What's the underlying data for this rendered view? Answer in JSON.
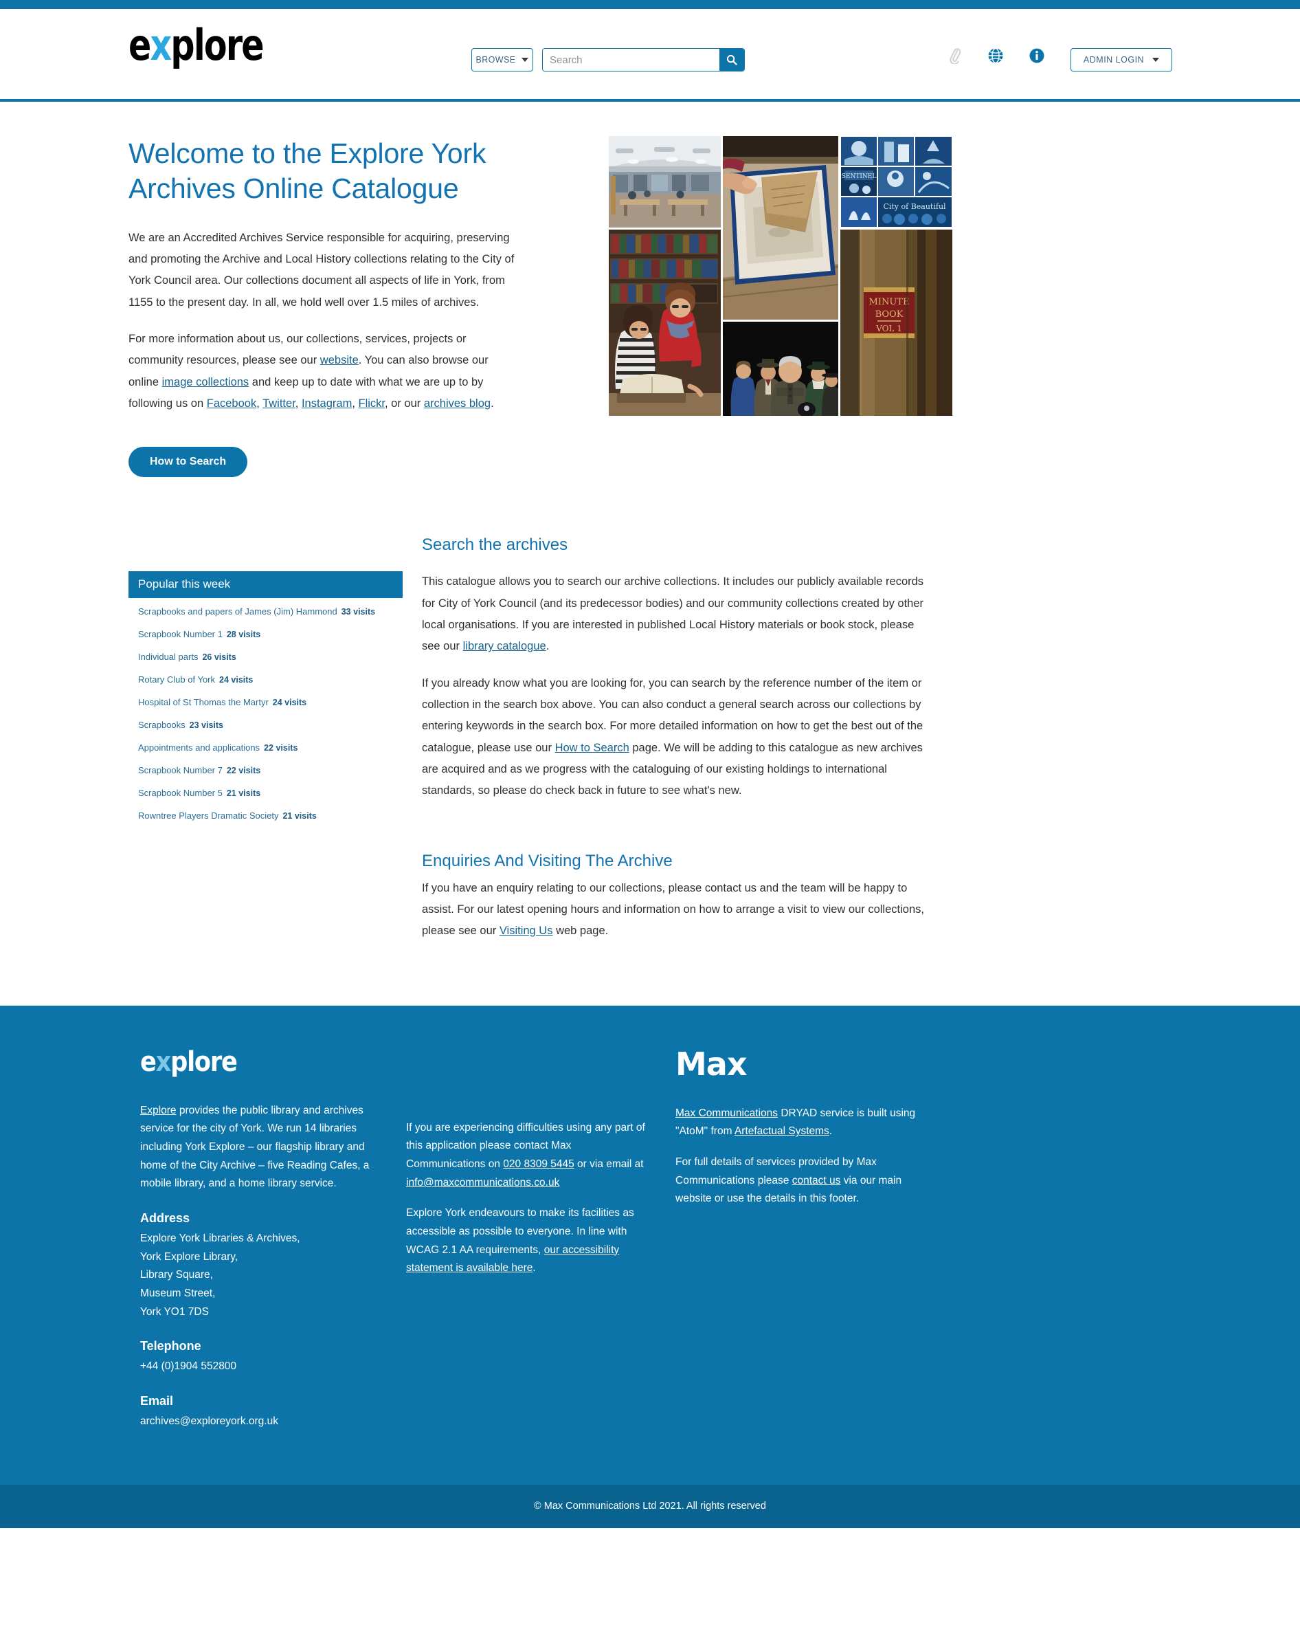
{
  "header": {
    "logo_pre": "e",
    "logo_x": "x",
    "logo_post": "plore",
    "browse_label": "BROWSE",
    "search_placeholder": "Search",
    "search_value": "",
    "admin_label": "ADMIN LOGIN",
    "icons": [
      "paperclip-icon",
      "globe-icon",
      "info-icon"
    ]
  },
  "hero": {
    "title": "Welcome to the Explore York Archives Online Catalogue",
    "para1": "We are an Accredited Archives Service responsible for acquiring, preserving and promoting the Archive and Local History collections relating to the City of York Council area. Our collections document all aspects of life in York, from 1155 to the present day. In all, we hold well over 1.5 miles of archives.",
    "para2_a": "For more information about us, our collections, services, projects or community resources, please see our ",
    "link_website": "website",
    "para2_b": ". You can also browse our online ",
    "link_image_collections": "image collections",
    "para2_c": " and keep up to date with what we are up to by following us on ",
    "link_facebook": "Facebook",
    "link_twitter": "Twitter",
    "link_instagram": "Instagram",
    "link_flickr": "Flickr",
    "para2_d": ", or our ",
    "link_archives_blog": "archives blog",
    "para2_e": ".",
    "cta_label": "How to Search",
    "collage_alts": [
      "reading-room-photo",
      "archivist-handling-document-photo",
      "cyanotype-prints-grid-photo",
      "two-women-reading-large-book-photo",
      "theatre-cast-in-costume-photo",
      "minute-book-spine-photo"
    ]
  },
  "popular": {
    "heading": "Popular this week",
    "items": [
      {
        "title": "Scrapbooks and papers of James (Jim) Hammond",
        "visits": "33 visits"
      },
      {
        "title": "Scrapbook Number 1",
        "visits": "28 visits"
      },
      {
        "title": "Individual parts",
        "visits": "26 visits"
      },
      {
        "title": "Rotary Club of York",
        "visits": "24 visits"
      },
      {
        "title": "Hospital of St Thomas the Martyr",
        "visits": "24 visits"
      },
      {
        "title": "Scrapbooks",
        "visits": "23 visits"
      },
      {
        "title": "Appointments and applications",
        "visits": "22 visits"
      },
      {
        "title": "Scrapbook Number 7",
        "visits": "22 visits"
      },
      {
        "title": "Scrapbook Number 5",
        "visits": "21 visits"
      },
      {
        "title": "Rowntree Players Dramatic Society",
        "visits": "21 visits"
      }
    ]
  },
  "search_section": {
    "heading": "Search the archives",
    "para1_a": "This catalogue allows you to search our archive collections. It includes our publicly available records for City of York Council (and its predecessor bodies) and our community collections created by other local organisations. If you are interested in published Local History materials or book stock, please see our ",
    "link_library_catalogue": "library catalogue",
    "para1_b": ".",
    "para2_a": "If you already know what you are looking for, you can search by the reference number of the item or collection in the search box above. You can also conduct a general search across our collections by entering keywords in the search box. For more detailed information on how to get the best out of the catalogue, please use our ",
    "link_how_to_search": "How to Search",
    "para2_b": " page. We will be adding to this catalogue as new archives are acquired and as we progress with the cataloguing of our existing holdings to international standards, so please do check back in future to see what's new."
  },
  "enquiries_section": {
    "heading": "Enquiries And Visiting The Archive",
    "para_a": "If you have an enquiry relating to our collections, please contact us and the team will be happy to assist. For our latest opening hours and information on how to arrange a visit to view our collections, please see our ",
    "link_visiting_us": "Visiting Us",
    "para_b": " web page."
  },
  "footer": {
    "col1": {
      "logo_pre": "e",
      "logo_x": "x",
      "logo_post": "plore",
      "link_explore": "Explore",
      "intro_rest": " provides the public library and archives service for the city of York. We run 14 libraries including York Explore – our flagship library and home of the City Archive – five Reading Cafes, a mobile library, and a home library service.",
      "address_heading": "Address",
      "address_lines": [
        "Explore York Libraries & Archives,",
        "York Explore Library,",
        "Library Square,",
        "Museum Street,",
        "York YO1 7DS"
      ],
      "telephone_heading": "Telephone",
      "telephone": "+44 (0)1904 552800",
      "email_heading": "Email",
      "email": "archives@exploreyork.org.uk"
    },
    "col2": {
      "p1_a": "If you are experiencing difficulties using any part of this application please contact Max Communications on ",
      "phone_link": "020 8309 5445",
      "p1_b": " or via email at ",
      "email_link": "info@maxcommunications.co.uk",
      "p2_a": "Explore York endeavours to make its facilities as accessible as possible to everyone. In line with WCAG 2.1 AA requirements, ",
      "accessibility_link": "our accessibility statement is available here",
      "p2_b": "."
    },
    "col3": {
      "logo": "Max",
      "p1_link1": "Max Communications",
      "p1_mid": " DRYAD service is built using \"AtoM\" from ",
      "p1_link2": "Artefactual Systems",
      "p1_end": ".",
      "p2_a": "For full details of services provided by Max Communications please ",
      "p2_link": "contact us",
      "p2_b": " via our main website or use the details in this footer."
    },
    "copyright": "© Max Communications Ltd 2021. All rights reserved"
  },
  "colors": {
    "brand_blue": "#0C74A8",
    "brand_blue_dark": "#0A628F",
    "heading_blue": "#1273B0",
    "logo_accent": "#29A8E0",
    "link_blue": "#16638F"
  }
}
